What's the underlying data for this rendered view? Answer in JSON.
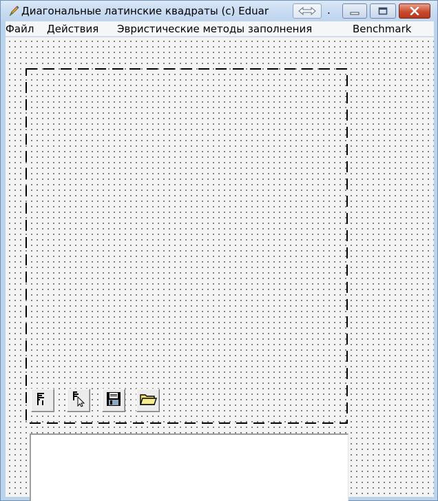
{
  "window": {
    "title": "Диагональные латинские квадраты (c) Eduar",
    "title_ellipsis": ".",
    "icons": {
      "app": "app-pen-icon",
      "resize": "double-arrow-icon",
      "minimize": "minimize-icon",
      "maximize": "maximize-icon",
      "close": "close-icon"
    },
    "colors": {
      "frame": "#bcd3ec",
      "close_button": "#c94a2e",
      "client_background": "#f4f4f4"
    }
  },
  "menu": {
    "items": [
      {
        "label": "Файл"
      },
      {
        "label": "Действия"
      },
      {
        "label": "Эвристические методы заполнения"
      },
      {
        "label": "Benchmark"
      }
    ]
  },
  "toolbar": {
    "buttons": [
      {
        "icon": "properties-icon"
      },
      {
        "icon": "select-pointer-icon"
      },
      {
        "icon": "save-disk-icon"
      },
      {
        "icon": "open-folder-icon"
      }
    ]
  },
  "memo": {
    "value": ""
  }
}
